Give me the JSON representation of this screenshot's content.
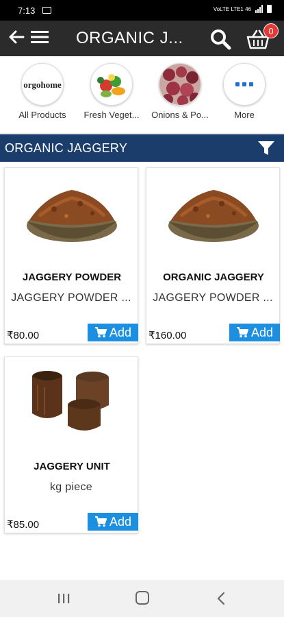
{
  "status_bar": {
    "time": "7:13",
    "network": "VoLTE LTE1 46"
  },
  "app_bar": {
    "title": "ORGANIC J...",
    "cart_count": "0"
  },
  "categories": [
    {
      "label": "All Products",
      "logo_text": "orgohome"
    },
    {
      "label": "Fresh Veget..."
    },
    {
      "label": "Onions & Po..."
    },
    {
      "label": "More"
    }
  ],
  "section": {
    "title": "ORGANIC JAGGERY"
  },
  "products": [
    {
      "name": "JAGGERY POWDER",
      "desc": "JAGGERY POWDER ...",
      "price": "₹80.00",
      "add_label": "Add"
    },
    {
      "name": "ORGANIC JAGGERY",
      "desc": "JAGGERY POWDER ...",
      "price": "₹160.00",
      "add_label": "Add"
    },
    {
      "name": "JAGGERY UNIT",
      "desc": "kg piece",
      "price": "₹85.00",
      "add_label": "Add"
    }
  ],
  "colors": {
    "app_bar": "#2b2b2b",
    "section_bar": "#1b3d6b",
    "add_button": "#1d8fe0",
    "badge": "#e53935"
  }
}
